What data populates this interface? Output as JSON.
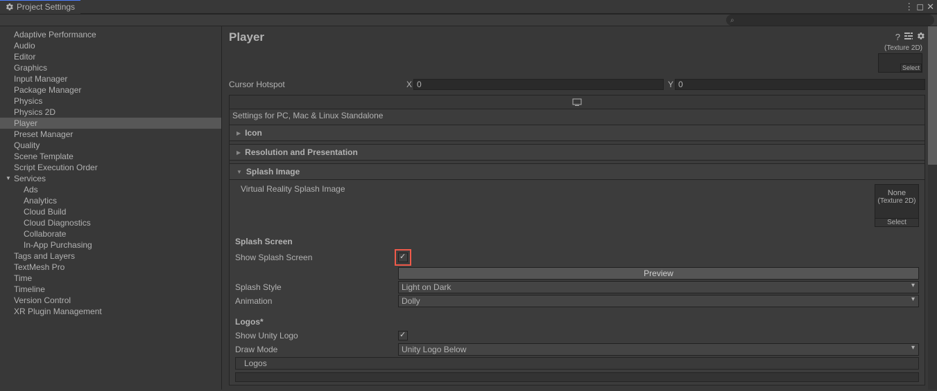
{
  "tab": {
    "title": "Project Settings"
  },
  "search": {
    "placeholder": ""
  },
  "sidebar": {
    "items": [
      "Adaptive Performance",
      "Audio",
      "Editor",
      "Graphics",
      "Input Manager",
      "Package Manager",
      "Physics",
      "Physics 2D",
      "Player",
      "Preset Manager",
      "Quality",
      "Scene Template",
      "Script Execution Order"
    ],
    "services": {
      "label": "Services",
      "items": [
        "Ads",
        "Analytics",
        "Cloud Build",
        "Cloud Diagnostics",
        "Collaborate",
        "In-App Purchasing"
      ]
    },
    "items_after": [
      "Tags and Layers",
      "TextMesh Pro",
      "Time",
      "Timeline",
      "Version Control",
      "XR Plugin Management"
    ]
  },
  "page": {
    "title": "Player"
  },
  "textureLabel": "(Texture 2D)",
  "selectLabel": "Select",
  "cursor": {
    "label": "Cursor Hotspot",
    "xLabel": "X",
    "xValue": "0",
    "yLabel": "Y",
    "yValue": "0"
  },
  "platform": {
    "label": "Settings for PC, Mac & Linux Standalone"
  },
  "sections": {
    "icon": "Icon",
    "resolution": "Resolution and Presentation",
    "splash": "Splash Image"
  },
  "splash": {
    "vrSplash": "Virtual Reality Splash Image",
    "noneLabel": "None",
    "tex2dLabel": "(Texture 2D)",
    "screenHeading": "Splash Screen",
    "showLabel": "Show Splash Screen",
    "preview": "Preview",
    "styleLabel": "Splash Style",
    "styleValue": "Light on Dark",
    "animLabel": "Animation",
    "animValue": "Dolly",
    "logosHeading": "Logos*",
    "showUnityLogo": "Show Unity Logo",
    "drawMode": "Draw Mode",
    "drawModeValue": "Unity Logo Below",
    "logosLabel": "Logos"
  }
}
